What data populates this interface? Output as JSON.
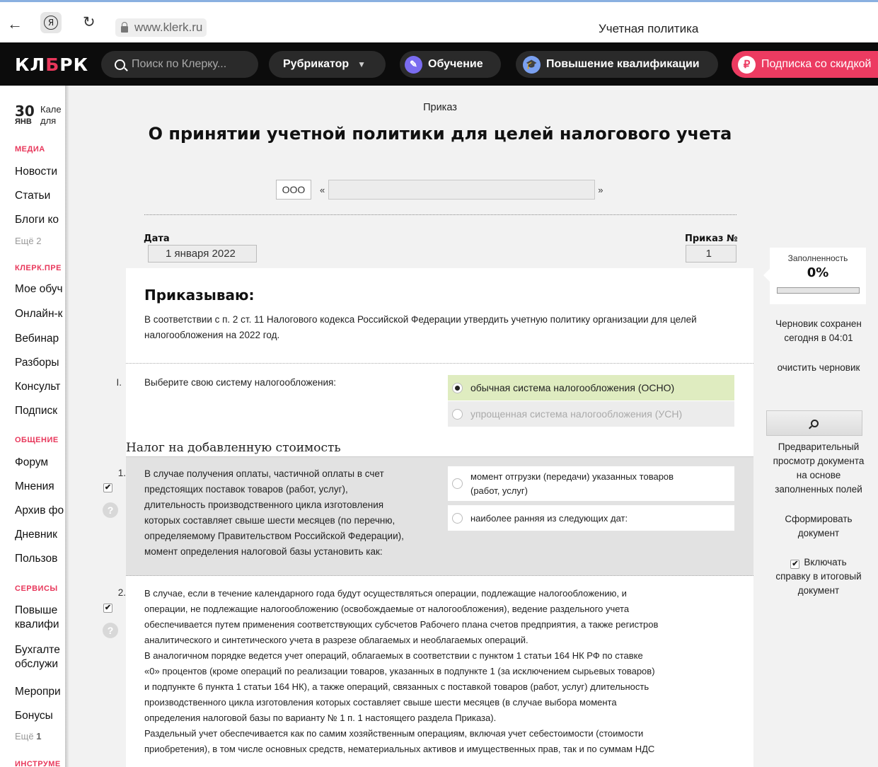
{
  "browser": {
    "url": "www.klerk.ru",
    "tab_title": "Учетная политика"
  },
  "header": {
    "logo_left": "КЛ",
    "logo_mid": "Б",
    "logo_right": "РК",
    "search_placeholder": "Поиск по Клерку...",
    "rubricator": "Рубрикатор",
    "education": "Обучение",
    "qualification": "Повышение квалификации",
    "subscription": "Подписка со скидкой",
    "subscription_badge": "₽"
  },
  "sidebar": {
    "date_day": "30",
    "date_month": "ЯНВ",
    "date_text_1": "Кале",
    "date_text_2": "для",
    "sections": [
      {
        "title": "МЕДИА",
        "items": [
          "Новости",
          "Статьи",
          "Блоги ко"
        ],
        "more": "Ещё 2"
      },
      {
        "title": "КЛЕРК.ПРЕ",
        "items": [
          "Мое обуч",
          "Онлайн-к",
          "Вебинар",
          "Разборы",
          "Консульт",
          "Подписк"
        ]
      },
      {
        "title": "ОБЩЕНИЕ",
        "items": [
          "Форум",
          "Мнения",
          "Архив фо",
          "Дневник",
          "Пользов"
        ]
      },
      {
        "title": "СЕРВИСЫ",
        "items": [
          "Повыше квалифи",
          "Бухгалте обслужи",
          "Меропри",
          "Бонусы"
        ],
        "more_label": "Ещё",
        "more_count": "1"
      },
      {
        "title": "ИНСТРУМЕ"
      }
    ]
  },
  "document": {
    "type": "Приказ",
    "title": "О принятии учетной политики для целей налогового учета",
    "org_type": "ООО",
    "quote_open": "«",
    "quote_close": "»",
    "org_name": "",
    "date_label": "Дата",
    "date_value": "1 января 2022",
    "order_label": "Приказ №",
    "order_value": "1",
    "order_heading": "Приказываю:",
    "order_text": "В соответствии с п. 2 ст. 11 Налогового кодекса Российской Федерации утвердить учетную политику организации для целей налогообложения на 2022 год.",
    "q1": {
      "num": "I.",
      "text": "Выберите свою систему налогообложения:",
      "options": [
        {
          "label": "обычная система налогообложения (ОСНО)",
          "selected": true
        },
        {
          "label": "упрощенная система налогообложения (УСН)",
          "selected": false
        }
      ]
    },
    "section_title": "Налог на добавленную стоимость",
    "item1": {
      "num": "1.",
      "checked": "✔",
      "help": "?",
      "text_lines": [
        "В случае получения оплаты, частичной оплаты в счет",
        "предстоящих поставок товаров (работ, услуг),",
        "длительность производственного цикла изготовления",
        "которых составляет свыше шести месяцев (по перечню,",
        "определяемому Правительством Российской Федерации),",
        "момент определения налоговой базы установить как:"
      ],
      "opt1_line1": "момент отгрузки (передачи) указанных товаров",
      "opt1_line2": "(работ, услуг)",
      "opt2": "наиболее ранняя из следующих дат:"
    },
    "item2": {
      "num": "2.",
      "checked": "✔",
      "help": "?",
      "text_lines": [
        "В случае, если в течение календарного года будут осуществляться операции, подлежащие налогообложению, и",
        "операции, не подлежащие налогообложению (освобождаемые от налогообложения), ведение раздельного учета",
        "обеспечивается путем применения соответствующих субсчетов Рабочего плана счетов предприятия, а также регистров",
        "аналитического и синтетического учета в разрезе облагаемых и необлагаемых операций.",
        "В аналогичном порядке ведется учет операций, облагаемых в соответствии с пунктом 1 статьи 164 НК РФ по ставке",
        "«0» процентов (кроме операций по реализации товаров, указанных в подпункте 1 (за исключением сырьевых товаров)",
        "и подпункте 6 пункта 1 статьи 164 НК), а также операций, связанных с поставкой товаров (работ, услуг) длительность",
        "производственного цикла изготовления которых составляет свыше шести месяцев (в случае выбора момента",
        "определения налоговой базы по варианту № 1 п. 1 настоящего раздела Приказа).",
        "Раздельный учет обеспечивается как по самим хозяйственным операциям, включая учет себестоимости (стоимости",
        "приобретения), в том числе основных средств, нематериальных активов и имущественных прав, так и по суммам НДС"
      ]
    }
  },
  "right_panel": {
    "fill_label": "Заполненность",
    "fill_value": "0%",
    "fill_fraction": 0,
    "draft_saved_1": "Черновик сохранен",
    "draft_saved_2": "сегодня в 04:01",
    "clear_draft": "очистить черновик",
    "preview_text": [
      "Предварительный",
      "просмотр документа",
      "на основе",
      "заполненных полей"
    ],
    "generate": [
      "Сформировать",
      "документ"
    ],
    "include_check": "✔",
    "include_text": [
      "Включать",
      "справку в итоговый",
      "документ"
    ]
  }
}
